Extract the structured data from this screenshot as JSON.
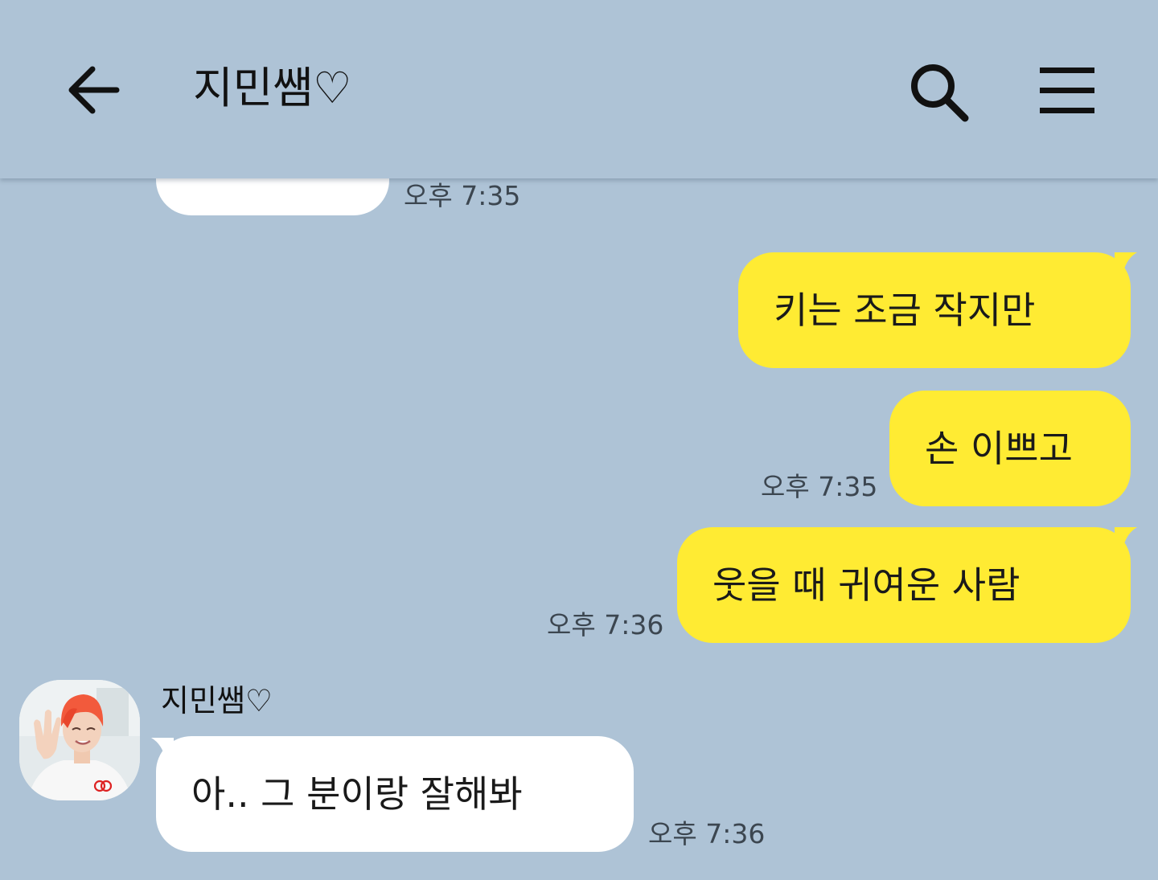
{
  "header": {
    "back_icon": "arrow-left-icon",
    "title": "지민쌤♡",
    "search_icon": "search-icon",
    "menu_icon": "hamburger-menu-icon"
  },
  "messages": [
    {
      "sender": "other",
      "text": "",
      "time": "오후 7:35"
    },
    {
      "sender": "me",
      "text": "키는 조금 작지만",
      "time": ""
    },
    {
      "sender": "me",
      "text": "손 이쁘고",
      "time": "오후 7:35"
    },
    {
      "sender": "me",
      "text": "웃을 때 귀여운 사람",
      "time": "오후 7:36"
    },
    {
      "sender": "other",
      "name": "지민쌤♡",
      "text": "아.. 그 분이랑 잘해봐",
      "time": "오후 7:36"
    }
  ],
  "colors": {
    "background": "#aec3d6",
    "my_bubble": "#ffeb33",
    "other_bubble": "#ffffff"
  }
}
